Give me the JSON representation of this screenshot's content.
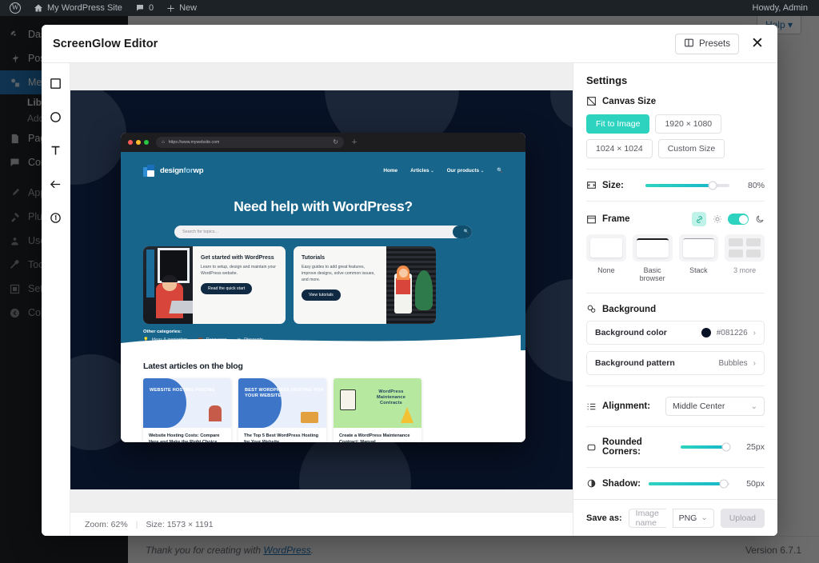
{
  "wp_admin": {
    "adminbar": {
      "logo_icon": "wordpress-logo-icon",
      "site_name": "My WordPress Site",
      "comments_count": "0",
      "new_label": "New",
      "howdy": "Howdy, Admin"
    },
    "sidebar": {
      "items": [
        {
          "label": "Dashboard",
          "icon": "dashboard-icon",
          "active": false
        },
        {
          "label": "Posts",
          "icon": "pin-icon",
          "active": false
        },
        {
          "label": "Media",
          "icon": "media-icon",
          "active": true
        },
        {
          "label": "Pages",
          "icon": "page-icon",
          "active": false
        },
        {
          "label": "Comments",
          "icon": "comment-icon",
          "active": false
        },
        {
          "label": "Appearance",
          "icon": "brush-icon",
          "active": false
        },
        {
          "label": "Plugins",
          "icon": "plugin-icon",
          "active": false
        },
        {
          "label": "Users",
          "icon": "users-icon",
          "active": false
        },
        {
          "label": "Tools",
          "icon": "wrench-icon",
          "active": false
        },
        {
          "label": "Settings",
          "icon": "settings-icon",
          "active": false
        },
        {
          "label": "Collapse menu",
          "icon": "collapse-icon",
          "active": false
        }
      ],
      "submenu": [
        {
          "label": "Library",
          "current": true
        },
        {
          "label": "Add New Media File",
          "current": false
        }
      ]
    },
    "help_tab": "Help",
    "footer": {
      "thanks_prefix": "Thank you for creating with ",
      "thanks_link": "WordPress",
      "thanks_suffix": ".",
      "version": "Version 6.7.1"
    }
  },
  "modal": {
    "title": "ScreenGlow Editor",
    "presets_label": "Presets",
    "presets_icon": "presets-panel-icon",
    "close_icon": "close-icon"
  },
  "tools": [
    {
      "name": "rectangle-tool",
      "icon": "square-icon"
    },
    {
      "name": "ellipse-tool",
      "icon": "circle-icon"
    },
    {
      "name": "text-tool",
      "icon": "text-t-icon"
    },
    {
      "name": "arrow-tool",
      "icon": "arrow-left-icon"
    },
    {
      "name": "step-number-tool",
      "icon": "number-badge-icon"
    }
  ],
  "canvas_status": {
    "zoom_label": "Zoom: 62%",
    "separator": "|",
    "size_label": "Size: 1573 × 1191"
  },
  "preview": {
    "browser": {
      "url": "https://www.mywebsite.com",
      "shield_icon": "shield-icon",
      "reload_icon": "reload-icon",
      "newtab_icon": "plus-icon",
      "traffic_lights": [
        "#ff5f57",
        "#febc2e",
        "#28c840"
      ]
    },
    "site": {
      "brand_strong": "design",
      "brand_light": "for",
      "brand_strong2": "wp",
      "nav": [
        {
          "label": "Home",
          "caret": false
        },
        {
          "label": "Articles",
          "caret": true
        },
        {
          "label": "Our products",
          "caret": true
        }
      ],
      "nav_search_icon": "search-icon",
      "hero_heading": "Need help with WordPress?",
      "search_placeholder": "Search for topics...",
      "search_button_icon": "search-icon",
      "cards": [
        {
          "heading": "Get started with WordPress",
          "body": "Learn to setup, design and maintain your WordPress website.",
          "button": "Read the quick start"
        },
        {
          "heading": "Tutorials",
          "body": "Easy guides to add great features, improve designs, solve common issues, and more.",
          "button": "View tutorials"
        }
      ],
      "other_categories_label": "Other categories:",
      "other_categories": [
        {
          "label": "Ideas & inspiration",
          "icon": "lightbulb-icon"
        },
        {
          "label": "Resources",
          "icon": "briefcase-icon"
        },
        {
          "label": "Discounts",
          "icon": "scissors-icon"
        }
      ],
      "blog_heading": "Latest articles on the blog",
      "posts": [
        {
          "kicker": "WEBSITE HOSTING PRICING",
          "title": "Website Hosting Costs: Compare Here and Make the Right Choice",
          "theme": "blue"
        },
        {
          "kicker": "BEST WORDPRESS HOSTING FOR YOUR WEBSITE",
          "title": "The Top 5 Best WordPress Hosting for Your Website",
          "theme": "blue"
        },
        {
          "kicker": "WordPress Maintenance Contracts",
          "title": "Create a WordPress Maintenance Contract: Manual",
          "theme": "green"
        }
      ]
    }
  },
  "settings": {
    "title": "Settings",
    "canvas_size": {
      "label": "Canvas Size",
      "icon": "canvas-size-icon",
      "options": [
        {
          "label": "Fit to Image",
          "active": true
        },
        {
          "label": "1920 × 1080",
          "active": false
        },
        {
          "label": "1024 × 1024",
          "active": false
        },
        {
          "label": "Custom Size",
          "active": false
        }
      ]
    },
    "size": {
      "label": "Size:",
      "icon": "resize-icon",
      "value": "80%",
      "percent": 80
    },
    "frame": {
      "label": "Frame",
      "icon": "frame-icon",
      "link_icon": "link-icon",
      "light_icon": "sun-icon",
      "dark_icon": "moon-icon",
      "toggle_on": true,
      "options": [
        {
          "label": "None",
          "style": "none"
        },
        {
          "label": "Basic browser",
          "style": "bar"
        },
        {
          "label": "Stack",
          "style": "thin"
        },
        {
          "label": "3 more",
          "style": "more"
        }
      ]
    },
    "background": {
      "label": "Background",
      "icon": "background-icon",
      "items": [
        {
          "label": "Background color",
          "value": "#081226",
          "swatch": "#081226",
          "chevron": "›"
        },
        {
          "label": "Background pattern",
          "value": "Bubbles",
          "swatch": null,
          "chevron": "›"
        }
      ]
    },
    "alignment": {
      "label": "Alignment:",
      "icon": "alignment-icon",
      "value": "Middle Center",
      "chevron": "⌄"
    },
    "rounded_corners": {
      "label": "Rounded Corners:",
      "icon": "rounded-corner-icon",
      "value": "25px",
      "percent": 93
    },
    "shadow": {
      "label": "Shadow:",
      "icon": "shadow-icon",
      "value": "50px",
      "percent": 93
    },
    "save": {
      "label": "Save as:",
      "name_placeholder": "Image name",
      "format": "PNG",
      "format_chevron": "⌄",
      "upload_label": "Upload"
    }
  }
}
